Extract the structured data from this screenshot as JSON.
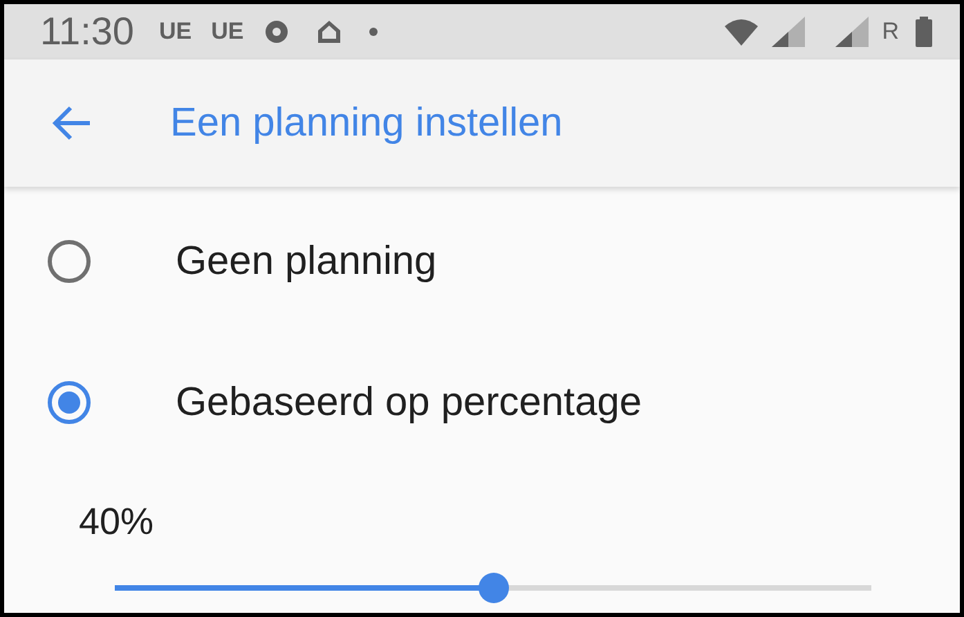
{
  "status_bar": {
    "time": "11:30",
    "notifications": [
      "UE",
      "UE"
    ],
    "network_letter": "R"
  },
  "toolbar": {
    "title": "Een planning instellen"
  },
  "options": [
    {
      "label": "Geen planning",
      "selected": false
    },
    {
      "label": "Gebaseerd op percentage",
      "selected": true
    }
  ],
  "slider": {
    "reading": "40%",
    "level": 0.5
  }
}
